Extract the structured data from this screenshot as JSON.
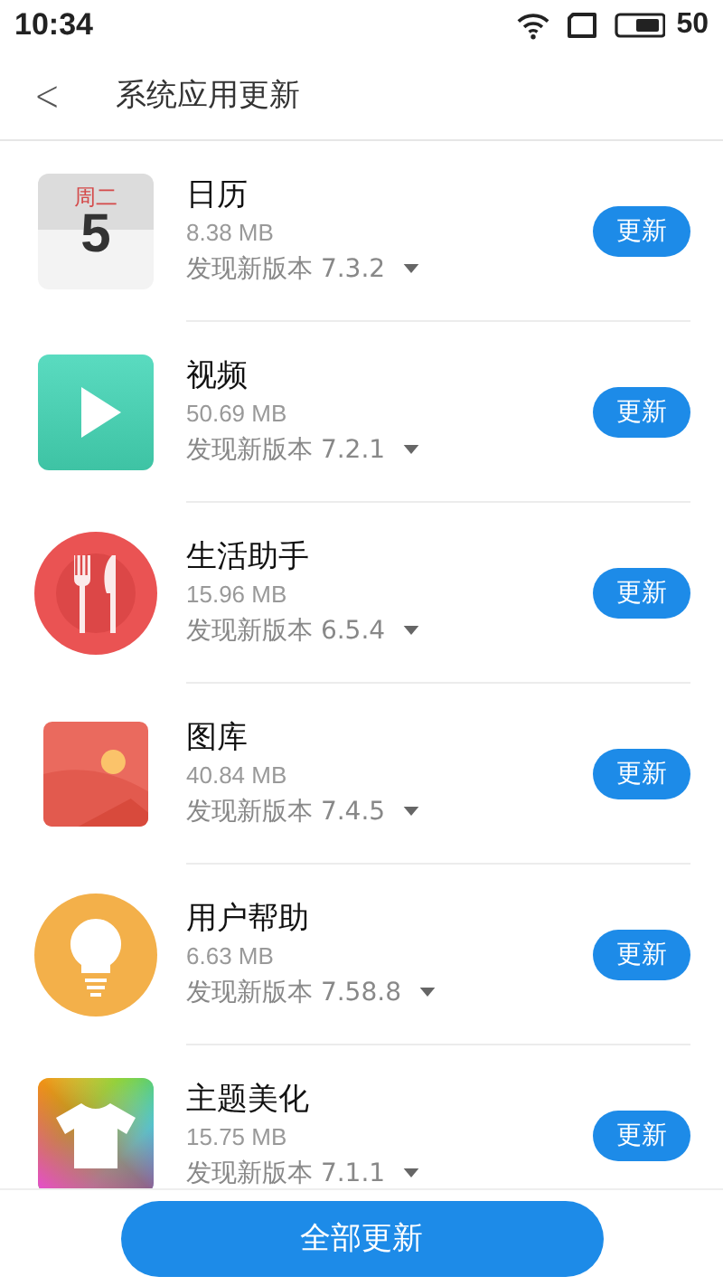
{
  "status_bar": {
    "time": "10:34",
    "battery": "50"
  },
  "header": {
    "back": "<",
    "title": "系统应用更新"
  },
  "apps": [
    {
      "name": "日历",
      "kind": "calendar",
      "calendar_weekday": "周二",
      "calendar_day": "5",
      "size": "8.38 MB",
      "version": "发现新版本 7.3.2",
      "button": "更新"
    },
    {
      "name": "视频",
      "kind": "video",
      "size": "50.69 MB",
      "version": "发现新版本 7.2.1",
      "button": "更新"
    },
    {
      "name": "生活助手",
      "kind": "cutlery",
      "size": "15.96 MB",
      "version": "发现新版本 6.5.4",
      "button": "更新"
    },
    {
      "name": "图库",
      "kind": "gallery",
      "size": "40.84 MB",
      "version": "发现新版本 7.4.5",
      "button": "更新"
    },
    {
      "name": "用户帮助",
      "kind": "bulb",
      "size": "6.63 MB",
      "version": "发现新版本 7.58.8",
      "button": "更新"
    },
    {
      "name": "主题美化",
      "kind": "shirt",
      "size": "15.75 MB",
      "version": "发现新版本 7.1.1",
      "button": "更新"
    }
  ],
  "update_all": "全部更新"
}
